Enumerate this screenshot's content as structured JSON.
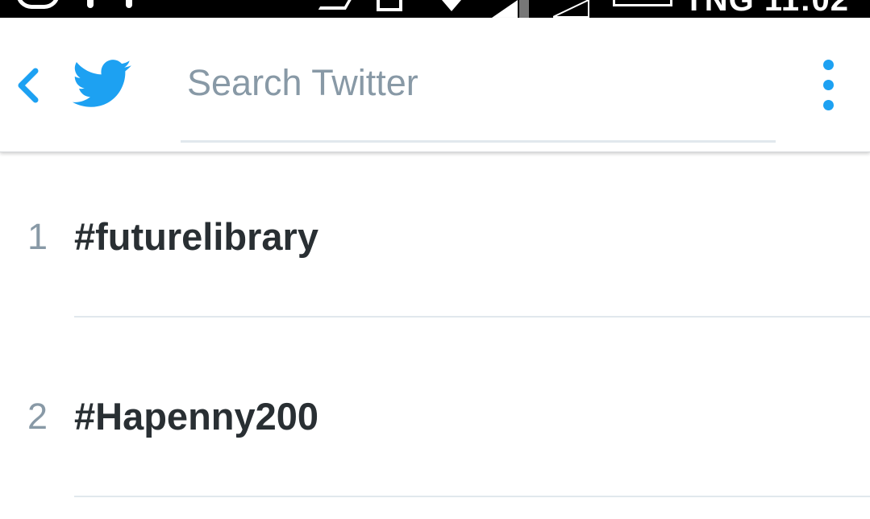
{
  "status_bar": {
    "time": "TNG 11:02"
  },
  "toolbar": {
    "search_placeholder": "Search Twitter"
  },
  "icons": {
    "back": "chevron-left-icon",
    "logo": "twitter-bird-icon",
    "menu": "more-vertical-icon"
  },
  "colors": {
    "accent": "#1da1f2",
    "trend_text": "#292f33",
    "rank_text": "#8899a6",
    "divider": "#e1e8ed"
  },
  "trends": [
    {
      "rank": "1",
      "name": "#futurelibrary"
    },
    {
      "rank": "2",
      "name": "#Hapenny200"
    }
  ]
}
